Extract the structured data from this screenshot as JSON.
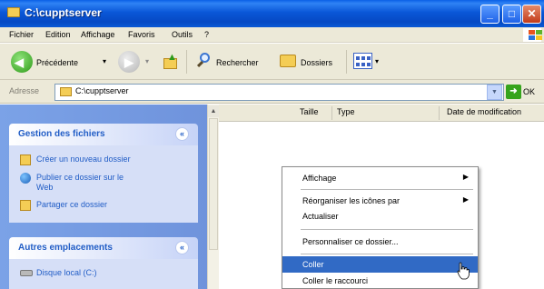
{
  "window": {
    "title": "C:\\cupptserver",
    "buttons": {
      "minimize": "_",
      "maximize": "□",
      "close": "✕"
    }
  },
  "menubar": {
    "items": [
      "Fichier",
      "Edition",
      "Affichage",
      "Favoris",
      "Outils",
      "?"
    ]
  },
  "toolbar": {
    "back_label": "Précédente",
    "search_label": "Rechercher",
    "folders_label": "Dossiers",
    "dropdown_glyph": "▾"
  },
  "address": {
    "label": "Adresse",
    "value": "C:\\cupptserver",
    "go_label": "OK",
    "go_glyph": "➜",
    "drop_glyph": "▼"
  },
  "taskpane": {
    "file_tasks": {
      "title": "Gestion des fichiers",
      "items": [
        {
          "line1": "Créer un nouveau dossier",
          "line2": ""
        },
        {
          "line1": "Publier ce dossier sur le",
          "line2": "Web"
        },
        {
          "line1": "Partager ce dossier",
          "line2": ""
        }
      ]
    },
    "other_places": {
      "title": "Autres emplacements",
      "items": [
        "Disque local (C:)"
      ]
    },
    "collapse_glyph": "«"
  },
  "columns": {
    "headers": [
      "Taille",
      "Type",
      "Date de modification"
    ]
  },
  "context_menu": {
    "items": [
      {
        "label": "Affichage",
        "submenu": true
      },
      {
        "label": "Réorganiser les icônes par",
        "submenu": true
      },
      {
        "label": "Actualiser",
        "submenu": false
      },
      {
        "label": "Personnaliser ce dossier...",
        "submenu": false
      },
      {
        "label": "Coller",
        "submenu": false,
        "highlighted": true
      },
      {
        "label": "Coller le raccourci",
        "submenu": false
      }
    ],
    "submenu_glyph": "▶"
  },
  "colors": {
    "titlebar": "#0a57d8",
    "taskpane": "#7ba2e7",
    "highlight": "#316ac5",
    "link": "#215dc6"
  }
}
